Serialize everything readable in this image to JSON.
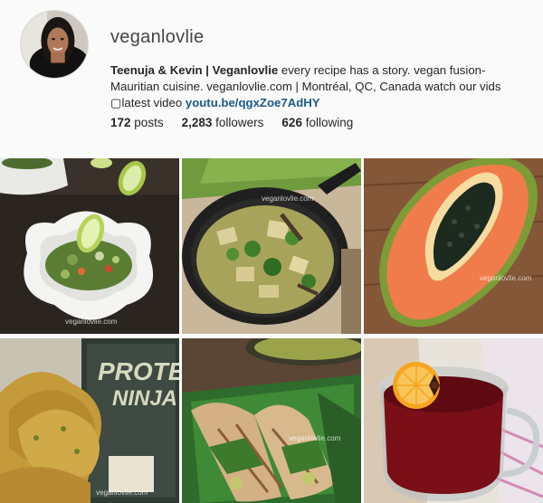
{
  "profile": {
    "username": "veganlovlie",
    "display_name": "Teenuja & Kevin | Veganlovlie",
    "bio_text": " every recipe has a story. vegan fusion- Mauritian cuisine. veganlovlie.com | Montréal, QC, Canada watch our vids ",
    "bio_tail": "latest video",
    "link_text": "youtu.be/qgxZoe7AdHY"
  },
  "stats": {
    "posts_count": "172",
    "posts_label": "posts",
    "followers_count": "2,283",
    "followers_label": "followers",
    "following_count": "626",
    "following_label": "following"
  },
  "posts": [
    {
      "subject": "salad in white flower bowl with lime",
      "watermark": "veganlovlie.com"
    },
    {
      "subject": "green curry in cast iron skillet",
      "watermark": "veganlovlie.com"
    },
    {
      "subject": "halved papaya with seeds",
      "watermark": "veganlovlie.com"
    },
    {
      "subject": "protein ninja cookbook with scones",
      "watermark": "veganlovlie.com"
    },
    {
      "subject": "wraps in banana leaves",
      "watermark": "veganlovlie.com"
    },
    {
      "subject": "red tea in glass mug with orange slice",
      "watermark": ""
    }
  ],
  "book_cover": {
    "line1": "PROTEIN",
    "line2": "NINJA"
  }
}
